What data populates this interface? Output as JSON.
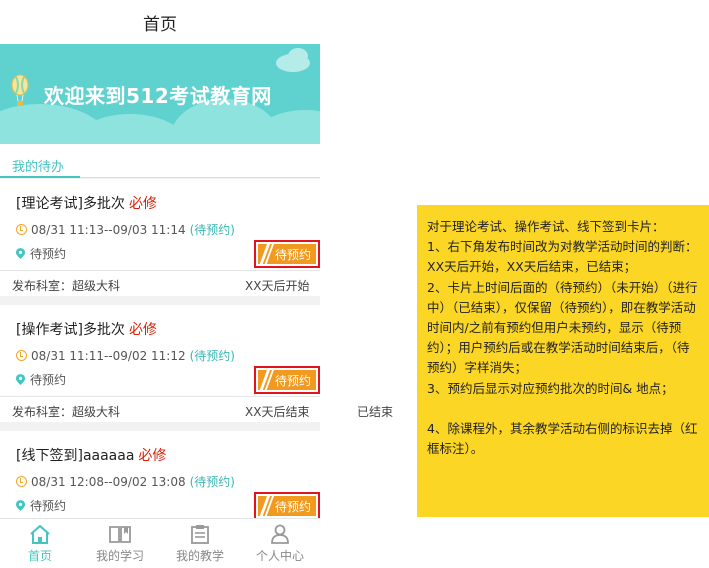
{
  "header": {
    "title": "首页"
  },
  "banner": {
    "title": "欢迎来到512考试教育网"
  },
  "tabs": {
    "active": "我的待办"
  },
  "cards": [
    {
      "type": "[理论考试]",
      "name": "多批次",
      "required": "必修",
      "time": "08/31 11:13--09/03 11:14",
      "time_status": "(待预约)",
      "location": "待预约",
      "button": "待预约",
      "dept": "发布科室：超级大科",
      "when": "XX天后开始"
    },
    {
      "type": "[操作考试]",
      "name": "多批次",
      "required": "必修",
      "time": "08/31 11:11--09/02 11:12",
      "time_status": "(待预约)",
      "location": "待预约",
      "button": "待预约",
      "dept": "发布科室：超级大科",
      "when": "XX天后结束"
    },
    {
      "type": "[线下签到]",
      "name": "aaaaaa",
      "required": "必修",
      "time": "08/31 12:08--09/02 13:08",
      "time_status": "(待预约)",
      "location": "待预约",
      "button": "待预约"
    }
  ],
  "side_status": "已结束",
  "tabbar": [
    {
      "label": "首页",
      "icon": "home-icon",
      "active": true
    },
    {
      "label": "我的学习",
      "icon": "book-icon",
      "active": false
    },
    {
      "label": "我的教学",
      "icon": "clipboard-icon",
      "active": false
    },
    {
      "label": "个人中心",
      "icon": "user-icon",
      "active": false
    }
  ],
  "note": {
    "lines": [
      "对于理论考试、操作考试、线下签到卡片：",
      "1、右下角发布时间改为对教学活动时间的判断：XX天后开始，XX天后结束，已结束；",
      "2、卡片上时间后面的（待预约）（未开始）（进行中）（已结束），仅保留（待预约），即在教学活动时间内/之前有预约但用户未预约，显示（待预约）；用户预约后或在教学活动时间结束后，（待预约）字样消失；",
      "3、预约后显示对应预约批次的时间& 地点；",
      "",
      "4、除课程外，其余教学活动右侧的标识去掉（红框标注）。"
    ]
  },
  "colors": {
    "teal": "#43c5c2",
    "required_red": "#d81e06",
    "button_orange": "#f29a1f",
    "note_yellow": "#fcd625",
    "highlight_box": "#e0141d"
  }
}
